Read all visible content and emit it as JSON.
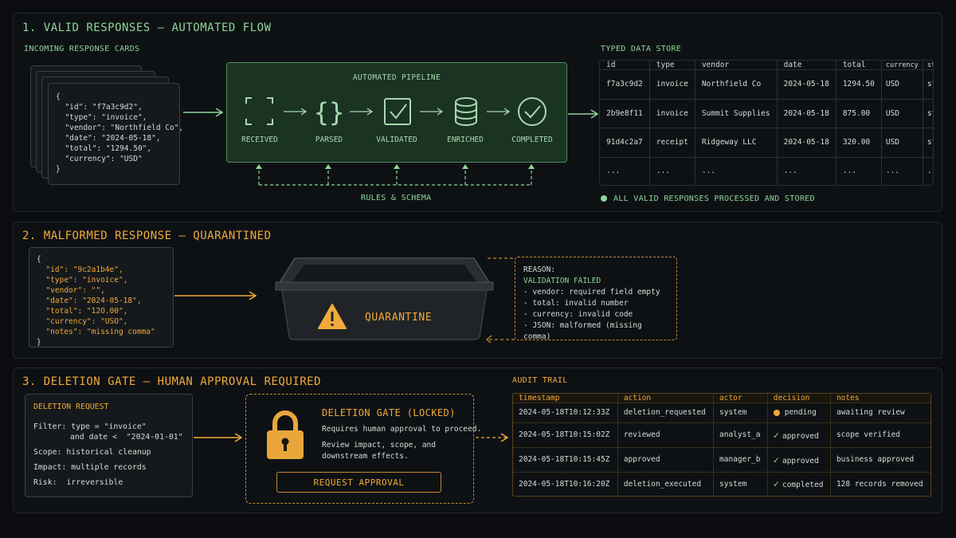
{
  "section1": {
    "title": "1. VALID RESPONSES — AUTOMATED FLOW",
    "incoming_label": "INCOMING RESPONSE CARDS",
    "card_json": [
      "{",
      "  \"id\": \"f7a3c9d2\",",
      "  \"type\": \"invoice\",",
      "  \"vendor\": \"Northfield Co\",",
      "  \"date\": \"2024-05-18\",",
      "  \"total\": \"1294.50\",",
      "  \"currency\": \"USD\"",
      "}"
    ],
    "pipeline_title": "AUTOMATED PIPELINE",
    "stages": [
      {
        "label": "RECEIVED",
        "icon": "brackets-frame-icon"
      },
      {
        "label": "PARSED",
        "icon": "curly-braces-icon"
      },
      {
        "label": "VALIDATED",
        "icon": "checkbox-icon"
      },
      {
        "label": "ENRICHED",
        "icon": "database-icon"
      },
      {
        "label": "COMPLETED",
        "icon": "check-circle-icon"
      }
    ],
    "rules_label": "RULES & SCHEMA",
    "store_label": "TYPED DATA STORE",
    "store_headers": [
      "id",
      "type",
      "vendor",
      "date",
      "total",
      "currency",
      "status"
    ],
    "store_rows": [
      [
        "f7a3c9d2",
        "invoice",
        "Northfield Co",
        "2024-05-18",
        "1294.50",
        "USD",
        "stored"
      ],
      [
        "2b9e8f11",
        "invoice",
        "Summit Supplies",
        "2024-05-18",
        "875.00",
        "USD",
        "stored"
      ],
      [
        "91d4c2a7",
        "receipt",
        "Ridgeway LLC",
        "2024-05-18",
        "320.00",
        "USD",
        "stored"
      ],
      [
        "...",
        "...",
        "...",
        "...",
        "...",
        "...",
        "..."
      ]
    ],
    "status_text": "ALL VALID RESPONSES PROCESSED AND STORED"
  },
  "section2": {
    "title": "2. MALFORMED RESPONSE — QUARANTINED",
    "card_json": [
      "{",
      "  \"id\": \"9c2a1b4e\",",
      "  \"type\": \"invoice\",",
      "  \"vendor\": \"\",",
      "  \"date\": \"2024-05-18\",",
      "  \"total\": \"12O.00\",",
      "  \"currency\": \"USO\",",
      "  \"notes\": \"missing comma\"",
      "}"
    ],
    "quarantine_label": "QUARANTINE",
    "reason_title": "REASON:",
    "reason_status": "VALIDATION FAILED",
    "reasons": [
      "- vendor: required field empty",
      "- total: invalid number",
      "- currency: invalid code",
      "- JSON: malformed (missing comma)"
    ]
  },
  "section3": {
    "title": "3. DELETION GATE — HUMAN APPROVAL REQUIRED",
    "request_title": "DELETION REQUEST",
    "filter_label": "Filter:",
    "filter_line1": "type = \"invoice\"",
    "filter_line2": "and date <  \"2024-01-01\"",
    "scope_label": "Scope:",
    "scope_value": "historical cleanup",
    "impact_label": "Impact:",
    "impact_value": "multiple records",
    "risk_label": "Risk:",
    "risk_value": "irreversible",
    "gate_title": "DELETION GATE (LOCKED)",
    "gate_line1": "Requires human approval to proceed.",
    "gate_line2": "Review impact, scope, and",
    "gate_line3": "downstream effects.",
    "approve_button": "REQUEST APPROVAL",
    "audit_label": "AUDIT TRAIL",
    "audit_headers": [
      "timestamp",
      "action",
      "actor",
      "decision",
      "notes"
    ],
    "audit_rows": [
      {
        "timestamp": "2024-05-18T10:12:33Z",
        "action": "deletion_requested",
        "actor": "system",
        "decision": "pending",
        "decision_icon": "pending-dot-icon",
        "notes": "awaiting review"
      },
      {
        "timestamp": "2024-05-18T10:15:02Z",
        "action": "reviewed",
        "actor": "analyst_a",
        "decision": "approved",
        "decision_icon": "check-icon",
        "notes": "scope verified"
      },
      {
        "timestamp": "2024-05-18T10:15:45Z",
        "action": "approved",
        "actor": "manager_b",
        "decision": "approved",
        "decision_icon": "check-icon",
        "notes": "business approved"
      },
      {
        "timestamp": "2024-05-18T10:16:20Z",
        "action": "deletion_executed",
        "actor": "system",
        "decision": "completed",
        "decision_icon": "check-icon",
        "notes": "128 records removed"
      }
    ]
  },
  "colors": {
    "green": "#8fd59a",
    "orange": "#f0a93a",
    "background": "#0b0d10"
  }
}
